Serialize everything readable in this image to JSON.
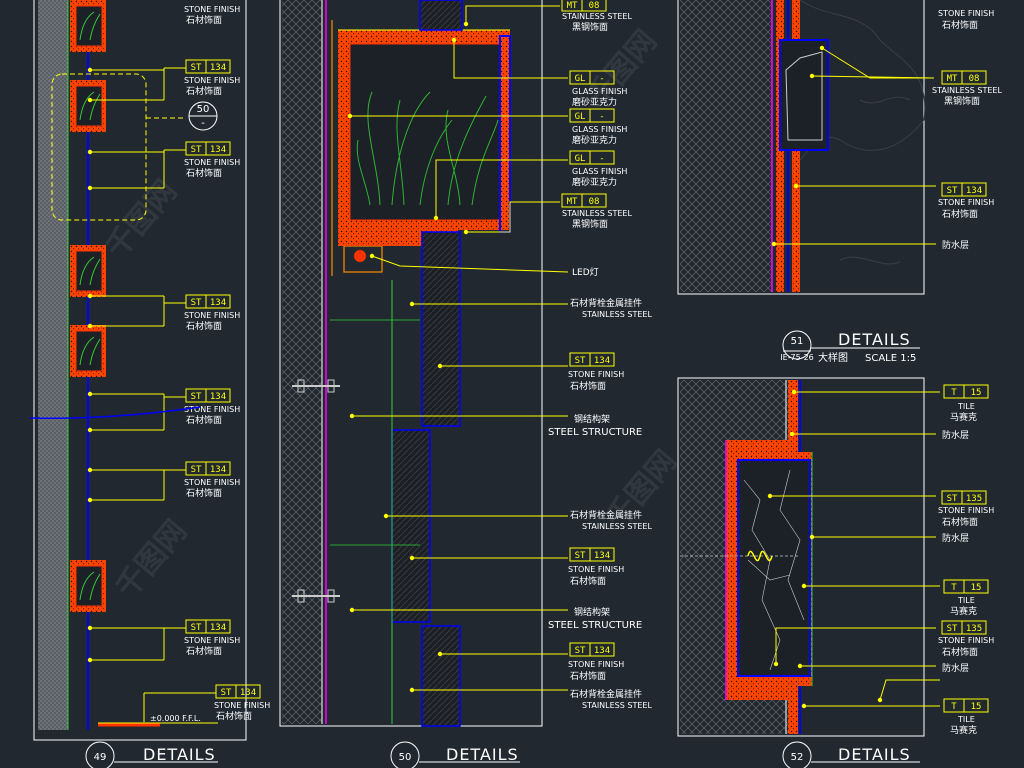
{
  "colors": {
    "background": "#212830",
    "leader": "#ffff00",
    "blue": "#0000ff",
    "magenta": "#ff00ff",
    "red": "#ff3300",
    "orange": "#ff8c00",
    "green": "#33cc33",
    "white": "#ffffff",
    "hatch": "#7a7a7a"
  },
  "tags": {
    "st134": {
      "code": "ST",
      "num": "134",
      "en": "STONE FINISH",
      "cn": "石材饰面"
    },
    "st135": {
      "code": "ST",
      "num": "135",
      "en": "STONE FINISH",
      "cn": "石材饰面"
    },
    "mt08": {
      "code": "MT",
      "num": "08",
      "en": "STAINLESS STEEL",
      "cn": "黑钢饰面"
    },
    "gl": {
      "code": "GL",
      "num": "-",
      "en": "GLASS FINISH",
      "cn": "磨砂亚克力"
    },
    "t15": {
      "code": "T",
      "num": "15",
      "en": "TILE",
      "cn": "马赛克"
    }
  },
  "panel49": {
    "callouts": [
      {
        "tag": "st134",
        "en": "STONE FINISH",
        "cn": "石材饰面"
      },
      {
        "tag": "st134",
        "en": "STONE FINISH",
        "cn": "石材饰面"
      },
      {
        "tag": "st134",
        "en": "STONE FINISH",
        "cn": "石材饰面"
      },
      {
        "tag": "st134",
        "en": "STONE FINISH",
        "cn": "石材饰面"
      },
      {
        "tag": "st134",
        "en": "STONE FINISH",
        "cn": "石材饰面"
      },
      {
        "tag": "st134",
        "en": "STONE FINISH",
        "cn": "石材饰面"
      },
      {
        "tag": "st134",
        "en": "STONE FINISH",
        "cn": "石材饰面"
      },
      {
        "tag": "st134",
        "en": "STONE FINISH",
        "cn": "石材饰面"
      }
    ],
    "zoom_bubble": "50",
    "zoom_bubble_sub": "-",
    "elevation": "±0.000 F.F.L.",
    "bubble": "49",
    "title": "DETAILS"
  },
  "panel50": {
    "labels": [
      {
        "tag": "mt08",
        "en": "STAINLESS STEEL",
        "cn": "黑钢饰面"
      },
      {
        "tag": "gl",
        "en": "GLASS FINISH",
        "cn": "磨砂亚克力"
      },
      {
        "tag": "gl",
        "en": "GLASS FINISH",
        "cn": "磨砂亚克力"
      },
      {
        "tag": "gl",
        "en": "GLASS FINISH",
        "cn": "磨砂亚克力"
      },
      {
        "tag": "mt08",
        "en": "STAINLESS STEEL",
        "cn": "黑钢饰面"
      }
    ],
    "led": "LED灯",
    "bracket1_cn": "石材背栓金属挂件",
    "bracket1_en": "STAINLESS STEEL",
    "st_a": {
      "en": "STONE FINISH",
      "cn": "石材饰面"
    },
    "steel_cn": "钢结构架",
    "steel_en": "STEEL STRUCTURE",
    "bracket2_cn": "石材背栓金属挂件",
    "bracket2_en": "STAINLESS STEEL",
    "st_b": {
      "en": "STONE FINISH",
      "cn": "石材饰面"
    },
    "steel2_cn": "钢结构架",
    "steel2_en": "STEEL STRUCTURE",
    "st_c": {
      "en": "STONE FINISH",
      "cn": "石材饰面"
    },
    "bracket3_cn": "石材背栓金属挂件",
    "bracket3_en": "STAINLESS STEEL",
    "bubble": "50",
    "title": "DETAILS"
  },
  "panel51": {
    "top_st": {
      "en": "STONE FINISH",
      "cn": "石材饰面"
    },
    "mt": {
      "en": "STAINLESS STEEL",
      "cn": "黑钢饰面"
    },
    "st": {
      "en": "STONE FINISH",
      "cn": "石材饰面"
    },
    "waterproof": "防水层",
    "bubble": "51",
    "bubble_ref": "IE-75-26",
    "title": "DETAILS",
    "subtitle": "大样图",
    "scale": "SCALE  1:5"
  },
  "panel52": {
    "tile1": {
      "en": "TILE",
      "cn": "马赛克"
    },
    "wp1": "防水层",
    "st1": {
      "en": "STONE FINISH",
      "cn": "石材饰面"
    },
    "wp2": "防水层",
    "tile2": {
      "en": "TILE",
      "cn": "马赛克"
    },
    "st2": {
      "en": "STONE FINISH",
      "cn": "石材饰面"
    },
    "wp3": "防水层",
    "tile3": {
      "en": "TILE",
      "cn": "马赛克"
    },
    "bubble": "52",
    "title": "DETAILS"
  },
  "watermark": "千图网"
}
